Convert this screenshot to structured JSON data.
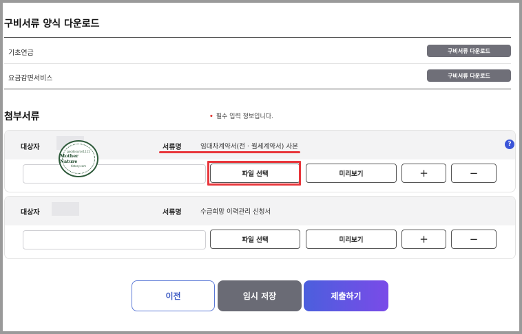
{
  "forms_section": {
    "title": "구비서류 양식 다운로드",
    "rows": [
      {
        "label": "기초연금",
        "button": "구비서류 다운로드"
      },
      {
        "label": "요금감면서비스",
        "button": "구비서류 다운로드"
      }
    ]
  },
  "attach_section": {
    "title": "첨부서류",
    "required_note": "필수 입력 정보입니다.",
    "required_mark": "•",
    "help": "?",
    "cards": [
      {
        "subject_label": "대상자",
        "doc_label": "서류명",
        "doc_name": "임대차계약서(전 · 월세계약서) 사본",
        "file_select": "파일 선택",
        "preview": "미리보기",
        "add": "+",
        "remove": "−"
      },
      {
        "subject_label": "대상자",
        "doc_label": "서류명",
        "doc_name": "수급희망 이력관리 신청서",
        "file_select": "파일 선택",
        "preview": "미리보기",
        "add": "+",
        "remove": "−"
      }
    ]
  },
  "watermark": {
    "top": "goodsource1111",
    "name": "Mother Nature",
    "bottom": "tistory.com"
  },
  "footer": {
    "prev": "이전",
    "temp_save": "임시 저장",
    "submit": "제출하기"
  },
  "colors": {
    "highlight": "#e8353a",
    "primary": "#4b5fdd",
    "dark_button": "#6a6b75"
  }
}
